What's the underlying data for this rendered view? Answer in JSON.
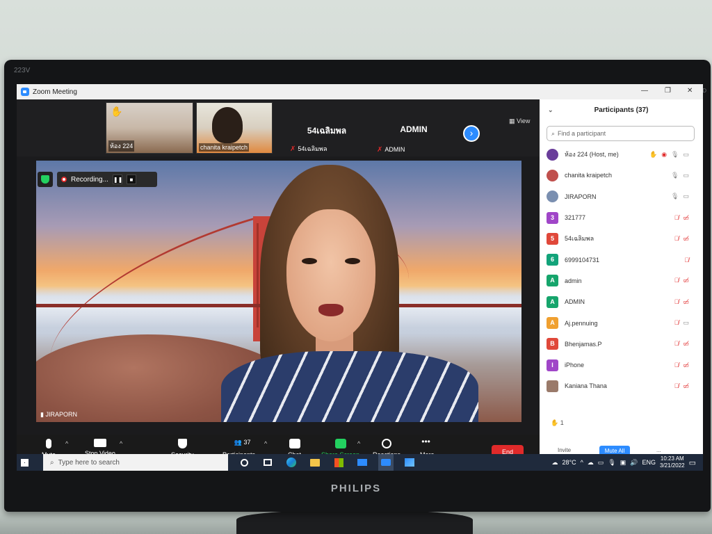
{
  "monitor": {
    "model": "223V",
    "led": "LED",
    "brand": "PHILIPS"
  },
  "window": {
    "title": "Zoom Meeting"
  },
  "strip": {
    "thumb1_name": "ห้อง 224",
    "thumb2_name": "chanita kraipetch",
    "tile1_big": "54เฉลิมพล",
    "tile1_small": "54เฉลิมพล",
    "tile2_big": "ADMIN",
    "tile2_small": "ADMIN",
    "view_label": "View"
  },
  "video": {
    "recording_label": "Recording...",
    "speaker_name": "JIRAPORN"
  },
  "toolbar": {
    "mute": "Mute",
    "stop_video": "Stop Video",
    "security": "Security",
    "participants": "Participants",
    "participants_count": "37",
    "chat": "Chat",
    "share_screen": "Share Screen",
    "reactions": "Reactions",
    "more": "More",
    "end": "End"
  },
  "panel": {
    "title": "Participants (37)",
    "search_placeholder": "Find a participant",
    "participants": [
      {
        "name": "ห้อง 224 (Host, me)",
        "avatar": "",
        "color": "#6a3d9a"
      },
      {
        "name": "chanita kraipetch",
        "avatar": "",
        "color": "#c0504d"
      },
      {
        "name": "JIRAPORN",
        "avatar": "",
        "color": "#7a8fb0"
      },
      {
        "name": "321777",
        "avatar": "3",
        "color": "#a046c8"
      },
      {
        "name": "54เฉลิมพล",
        "avatar": "5",
        "color": "#e0483a"
      },
      {
        "name": "6999104731",
        "avatar": "6",
        "color": "#12a37a"
      },
      {
        "name": "admin",
        "avatar": "A",
        "color": "#16a56c"
      },
      {
        "name": "ADMIN",
        "avatar": "A",
        "color": "#16a56c"
      },
      {
        "name": "Aj.pennuing",
        "avatar": "A",
        "color": "#f0a030"
      },
      {
        "name": "Bhenjamas.P",
        "avatar": "B",
        "color": "#e0483a"
      },
      {
        "name": "iPhone",
        "avatar": "I",
        "color": "#a046c8"
      },
      {
        "name": "Kaniana Thana",
        "avatar": "",
        "color": "#9a7a6a"
      }
    ],
    "raised_count": "1",
    "invite": "Invite",
    "mute_all": "Mute All",
    "more_dots": "..."
  },
  "taskbar": {
    "search_placeholder": "Type here to search",
    "temperature": "28°C",
    "lang": "ENG",
    "time": "10:23 AM",
    "date": "3/21/2022"
  }
}
